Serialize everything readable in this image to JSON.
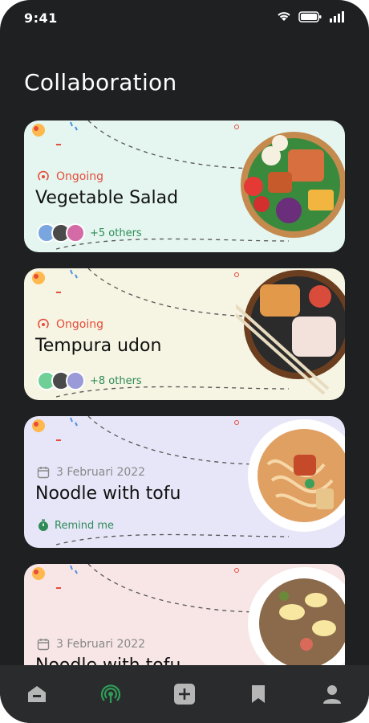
{
  "status": {
    "time": "9:41"
  },
  "page": {
    "title": "Collaboration"
  },
  "cards": [
    {
      "bg": "#e4f6ef",
      "status": "Ongoing",
      "name": "Vegetable Salad",
      "participants": "+5 others"
    },
    {
      "bg": "#f6f4e2",
      "status": "Ongoing",
      "name": "Tempura udon",
      "participants": "+8 others"
    },
    {
      "bg": "#e7e6f8",
      "date": "3 Februari 2022",
      "name": "Noodle with tofu",
      "reminder": "Remind me"
    },
    {
      "bg": "#f8e6e6",
      "date": "3 Februari 2022",
      "name": "Noodle with tofu"
    }
  ],
  "colors": {
    "accent": "#e74c3c",
    "green": "#2e8b57"
  },
  "nav": [
    "home-icon",
    "broadcast-icon",
    "add-icon",
    "bookmark-icon",
    "profile-icon"
  ]
}
